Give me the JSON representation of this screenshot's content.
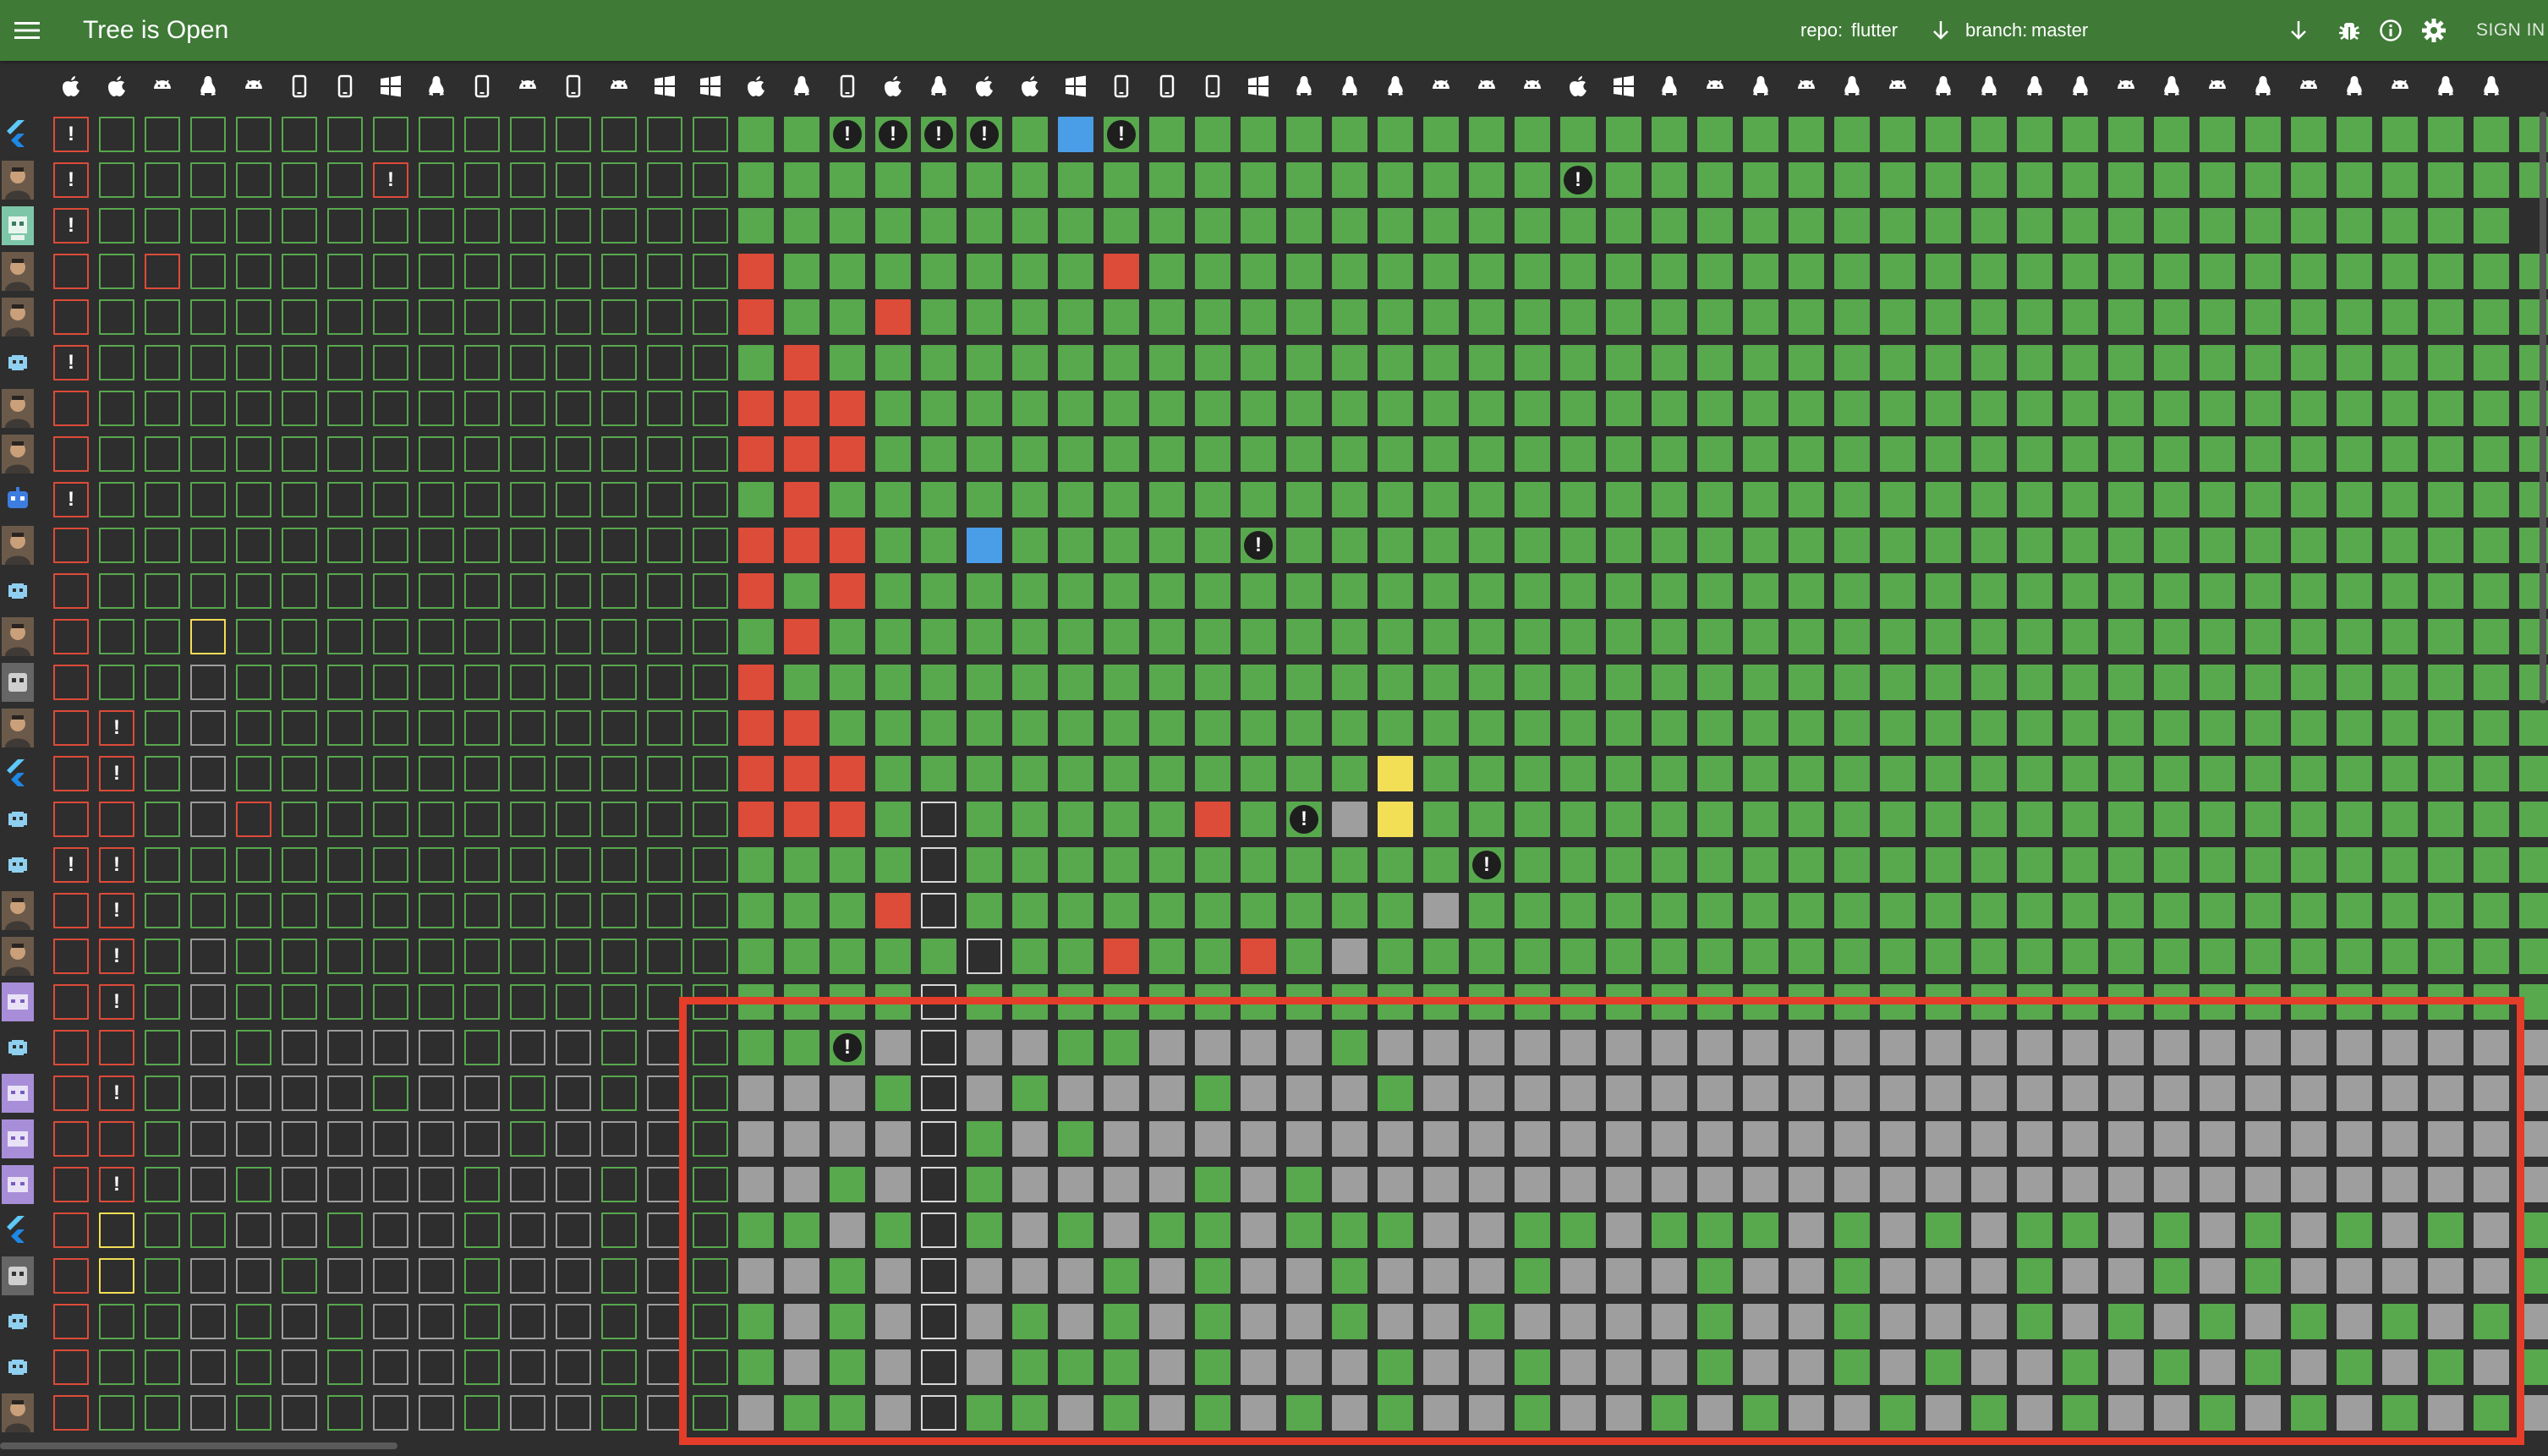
{
  "app_bar": {
    "title": "Tree is Open",
    "repo_label": "repo:",
    "repo_value": "flutter",
    "branch_label": "branch:",
    "branch_value": "master",
    "sign_in": "SIGN IN",
    "color": "#3f7a37",
    "icons": [
      "menu-icon",
      "arrow-down-icon",
      "download-icon",
      "bug-icon",
      "info-icon",
      "gear-icon"
    ]
  },
  "task_header": {
    "icons": "apple,apple,android,linux,android,mobile,mobile,windows,linux,mobile,android,mobile,android,windows,windows,apple,linux,mobile,apple,linux,apple,apple,windows,mobile,mobile,mobile,windows,linux,linux,linux,android,android,android,apple,windows,linux,android,linux,android,linux,android,linux,linux,linux,linux,android,linux,android,linux,android,linux,android,linux,linux"
  },
  "grid": {
    "legend_colors": {
      "succeeded": "#58a84e",
      "failed": "#dd4b39",
      "in_progress": "#4a9ee8",
      "flaky": "#f2df56",
      "skipped": "#9e9e9e"
    },
    "commits": [
      {
        "avatar": "flutter-logo",
        "status": "!...............g!!!!gb!gggggggggggggggggggggggggggggggggg"
      },
      {
        "avatar": "photo",
        "status": "!......!.........................!g..gggggggggggggggggggggggg"
      },
      {
        "avatar": "green-robot",
        "status": "!..............ggggggggggggggggggggggggggggggggggggggg"
      },
      {
        "avatar": "photo",
        "status": "r.r............rgggggggrggggggggggggggggggggggggggggggg"
      },
      {
        "avatar": "photo",
        "status": "r..............rggrgggggggggggggggggggggggggggggggggggg"
      },
      {
        "avatar": "alien",
        "status": "!..............grggggggggggggggggggggggggggggggggggggggg"
      },
      {
        "avatar": "photo",
        "status": "r..............rrrgggggggggggggggggggggggggggggggggggggg"
      },
      {
        "avatar": "photo",
        "status": "r..............rrrgggggggggggggggggggggggggggggggggggggg"
      },
      {
        "avatar": "blue-robot",
        "status": "!..............grggggggggggggggggggggggggggggggggggggggg"
      },
      {
        "avatar": "photo",
        "status": "r..............rrrggbggggg!ggggggggggggggggggggggggggggg"
      },
      {
        "avatar": "alien",
        "status": "r..............rgrgggggggggggggggggggggggggggggggggggggg"
      },
      {
        "avatar": "photo",
        "status": "r..y...........grggggggggggggggggggggggggggggggggggggggg"
      },
      {
        "avatar": "robot-grey",
        "status": "r..W...........rgggggggggggggggggggggggggggggggggggggggg"
      },
      {
        "avatar": "photo",
        "status": "r!.W...........rrggggggggggggggggggggggggggggggggggggggg"
      },
      {
        "avatar": "flutter-logo",
        "status": "r!.W...........rrrgggggggggggygggggggggggggggggggggggggg"
      },
      {
        "avatar": "alien",
        "status": "rr.Wr..........rrrgWgggggrg!syggggggggggggggggggggggggg"
      },
      {
        "avatar": "alien",
        "status": "!!.............ggggWggggggggggg!gggggggggggggggggggggggggg"
      },
      {
        "avatar": "photo",
        "status": "r!.............gggrWggggggggggsgggggggggggggggggggggggggg"
      },
      {
        "avatar": "photo",
        "status": "r!.W...........gggggWggrggrgsggggggggggggggggggggggggggg"
      },
      {
        "avatar": "purple-robot",
        "status": "r!.W...........ggggWgggggggggggggggggggggggggggggggggggg"
      },
      {
        "avatar": "alien",
        "status": "rr.WgWWWWgWWgWggg!sWssggssssgssssssssssssssssssssssssss"
      },
      {
        "avatar": "purple-robot",
        "status": "r!gWWWWgWWgWgWgsssgWsgsssgsssgsssssssssssssssssssssssss"
      },
      {
        "avatar": "purple-robot",
        "status": "rrgWWWWWWWgWWWgssssWgsgsssssssssssssssssssssssssssssssss"
      },
      {
        "avatar": "purple-robot",
        "status": "r!gWgWWWWgWWgWgssgsWgssssgsgsssssssssssssssssssssssssssss"
      },
      {
        "avatar": "flutter-logo",
        "status": "ryggWWgWWgWWgWgggsgWgsgsggsgggssggsgggsgsgsggsgsgsgsgsg"
      },
      {
        "avatar": "robot-grey",
        "status": "rygWWgWWWgWWgWgssgsWsssgsgssgsssgsssgssgsssgssgsgsssssgs"
      },
      {
        "avatar": "alien",
        "status": "r..WgWgWWgWWgWggsgsWsgsgsgssgssgssssgssgsssgsgsgsgsgsgs"
      },
      {
        "avatar": "alien",
        "status": "r..WgWgWWgWWgWggsgsWsgggsgsssgssgsssgssgsgssgsgsgsgsgsgs"
      },
      {
        "avatar": "photo",
        "status": "r..WgWgWWgWWgWgsggsWggsgsgsgsgssgssgsgssgsgsgssgsgsgsgsg"
      }
    ]
  }
}
